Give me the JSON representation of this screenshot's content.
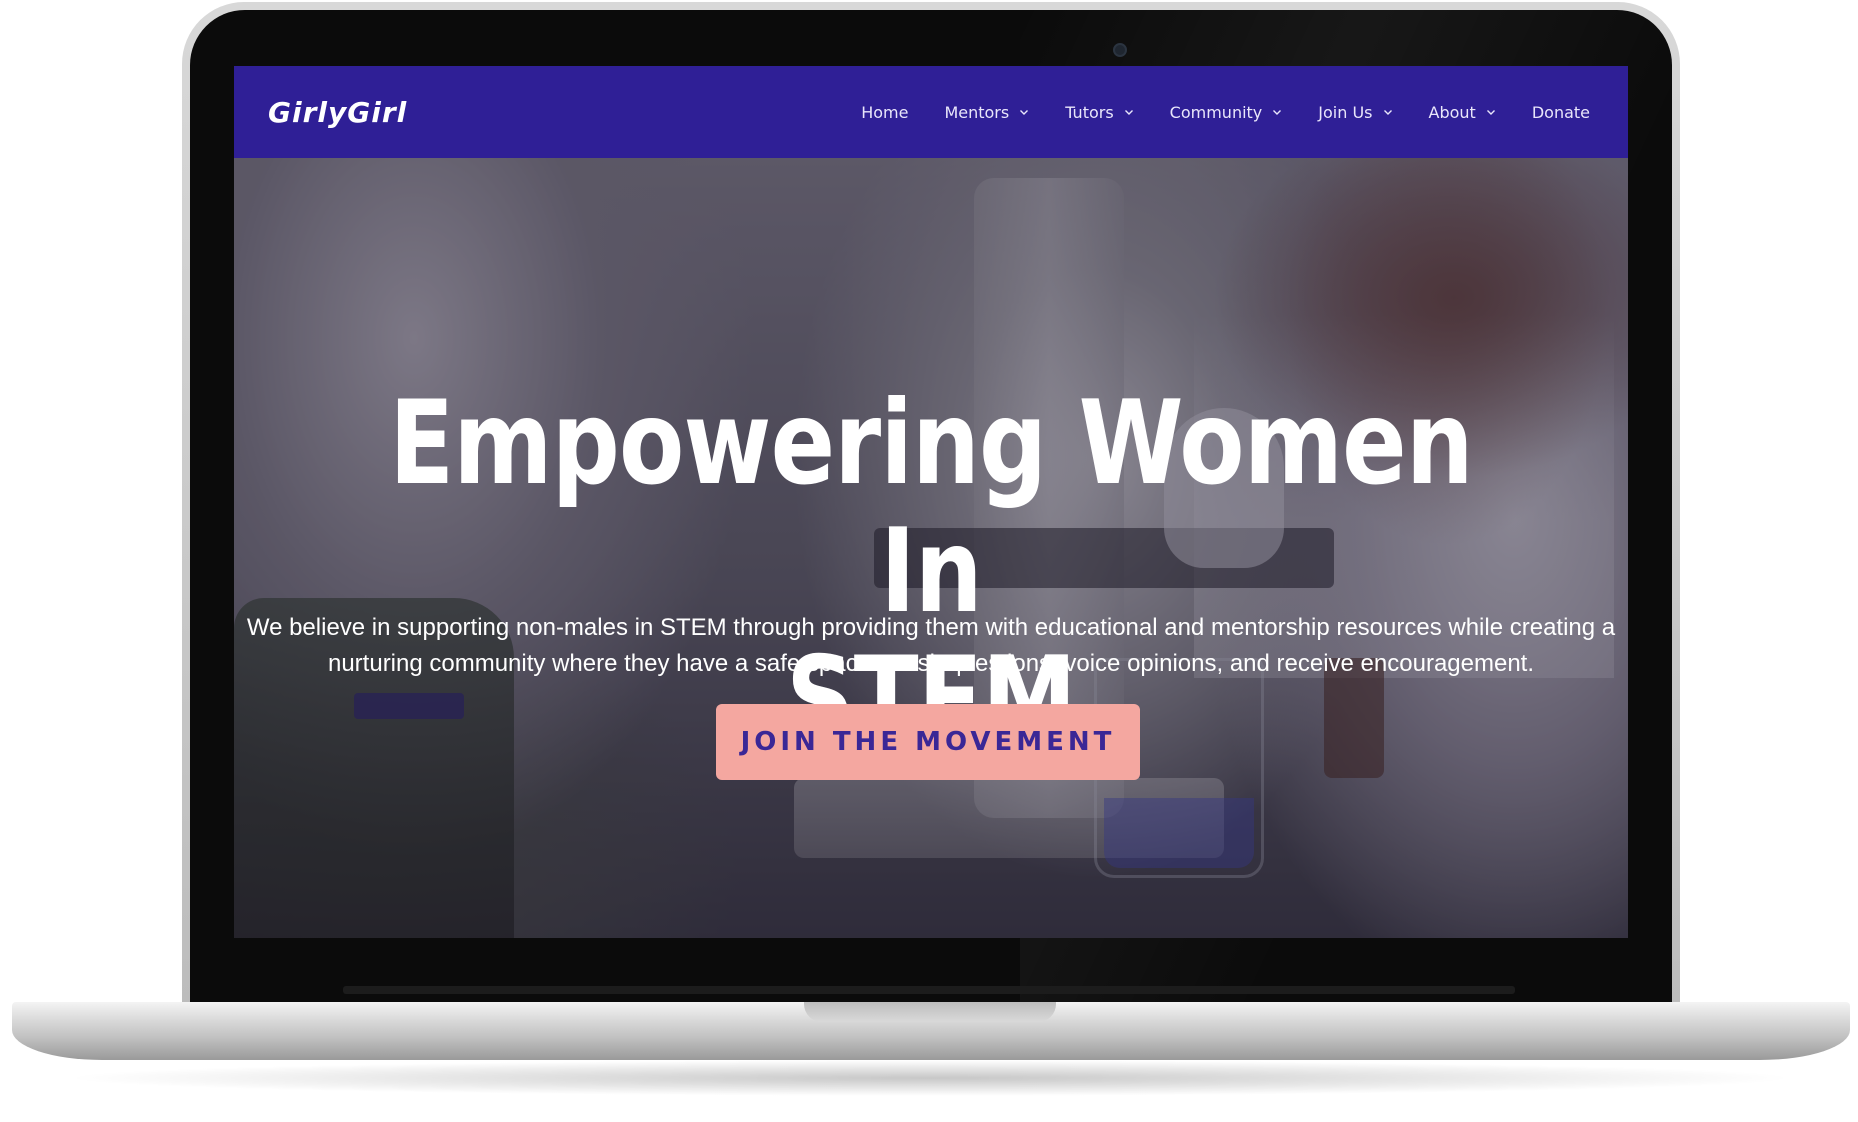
{
  "site": {
    "logo": "GirlyGirl"
  },
  "nav": {
    "items": [
      {
        "label": "Home",
        "has_dropdown": false
      },
      {
        "label": "Mentors",
        "has_dropdown": true
      },
      {
        "label": "Tutors",
        "has_dropdown": true
      },
      {
        "label": "Community",
        "has_dropdown": true
      },
      {
        "label": "Join Us",
        "has_dropdown": true
      },
      {
        "label": "About",
        "has_dropdown": true
      },
      {
        "label": "Donate",
        "has_dropdown": false
      }
    ]
  },
  "hero": {
    "headline_line1": "Empowering Women In",
    "headline_line2": "STEM",
    "tagline_line1": "We believe in supporting non-males in STEM through providing them with educational and mentorship resources while creating a",
    "tagline_line2": "nurturing community where they have a safe space to ask questions, voice opinions, and receive encouragement.",
    "cta_label": "JOIN THE MOVEMENT"
  },
  "colors": {
    "navbar": "#2f1f96",
    "cta_background": "#f4a7a0",
    "cta_text": "#3a2796"
  },
  "icons": {
    "dropdown": "chevron-down-icon",
    "camera": "camera-icon"
  }
}
